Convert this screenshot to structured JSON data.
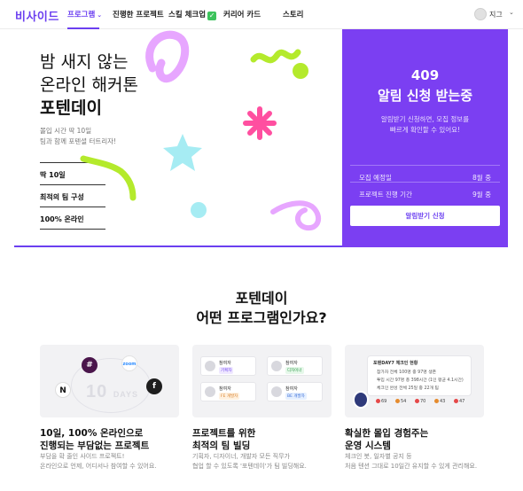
{
  "nav": {
    "logo": "비사이드",
    "items": [
      {
        "label": "프로그램"
      },
      {
        "label": "진행한 프로젝트"
      },
      {
        "label": "스킬 체크업"
      },
      {
        "label": "커리어 카드"
      },
      {
        "label": "스토리"
      }
    ],
    "chevron_glyph": "⌄",
    "skill_badge": "✓",
    "user": {
      "name": "지그",
      "chevron": "⌄"
    }
  },
  "hero": {
    "title_line1": "밤 새지 않는",
    "title_line2": "온라인 해커톤",
    "title_line3": "포텐데이",
    "subtitle_line1": "몰입 시간 딱 10일",
    "subtitle_line2": "팀과 함께 포텐셜 터트리자!",
    "facts": [
      "딱 10일",
      "최적의 팀 구성",
      "100% 온라인"
    ]
  },
  "panel": {
    "count": "409",
    "headline": "알림 신청 받는중",
    "desc_line1": "알림받기 신청하면, 모집 정보를",
    "desc_line2": "빠르게 확인할 수 있어요!",
    "rows": [
      {
        "key": "모집 예정일",
        "value": "8월 중"
      },
      {
        "key": "프로젝트 진행 기간",
        "value": "9월 중"
      }
    ],
    "button": "알림받기 신청"
  },
  "section": {
    "title_line1": "포텐데이",
    "title_line2": "어떤 프로그램인가요?"
  },
  "cards": [
    {
      "title_line1": "10일, 100% 온라인으로",
      "title_line2": "진행되는 부담없는 프로젝트",
      "desc_line1": "부담을 확 줄인 사이드 프로젝트!",
      "desc_line2": "온라인으로 언제, 어디서나 참여할 수 있어요.",
      "days_big": "10",
      "days_small": "DAYS"
    },
    {
      "title_line1": "프로젝트를 위한",
      "title_line2": "최적의 팀 빌딩",
      "desc_line1": "기획자, 디자이너, 개발자 모든 직무가",
      "desc_line2": "협업 할 수 있도록 '포텐데이'가 팀 빌딩해요.",
      "members": [
        {
          "name": "참여자",
          "role": "기획자"
        },
        {
          "name": "참여자",
          "role": "디자이너"
        },
        {
          "name": "참여자",
          "role": "FE 개발자"
        },
        {
          "name": "참여자",
          "role": "BE 개발자"
        }
      ]
    },
    {
      "title_line1": "확실한 몰입 경험주는",
      "title_line2": "운영 시스템",
      "desc_line1": "체크인 봇, 일자별 공지 등",
      "desc_line2": "처음 텐션 그대로 10일간 유지할 수 있게 관리해요.",
      "status_head": "포텐DAY7 체크인 현황",
      "status_rows": [
        "참가자  전체 100명 중 97명 생존",
        "투입 시간  97명 총 398시간 (1인 평균 4.1시간)",
        "체크인 완성  전체 25일 중 22개 팀"
      ],
      "streaks": [
        "69",
        "54",
        "70",
        "43",
        "47"
      ]
    }
  ],
  "colors": {
    "accent": "#6b3ff0",
    "panel": "#7b3ff2",
    "lime": "#b4ea2c",
    "pink": "#ff4fa0",
    "lilac": "#e7a6ff",
    "cyan": "#a6ecf3"
  }
}
